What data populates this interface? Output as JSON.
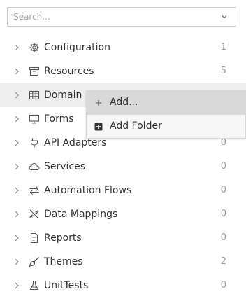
{
  "search": {
    "placeholder": "Search...",
    "value": ""
  },
  "tree": {
    "items": [
      {
        "label": "Configuration",
        "count": "1",
        "icon": "gear-icon"
      },
      {
        "label": "Resources",
        "count": "5",
        "icon": "archive-box-icon"
      },
      {
        "label": "Domain",
        "count": "",
        "icon": "table-grid-icon"
      },
      {
        "label": "Forms",
        "count": "",
        "icon": "monitor-icon"
      },
      {
        "label": "API Adapters",
        "count": "0",
        "icon": "plug-icon"
      },
      {
        "label": "Services",
        "count": "0",
        "icon": "cloud-icon"
      },
      {
        "label": "Automation Flows",
        "count": "0",
        "icon": "swap-arrows-icon"
      },
      {
        "label": "Data Mappings",
        "count": "0",
        "icon": "unlink-icon"
      },
      {
        "label": "Reports",
        "count": "0",
        "icon": "document-icon"
      },
      {
        "label": "Themes",
        "count": "2",
        "icon": "brush-icon"
      },
      {
        "label": "UnitTests",
        "count": "0",
        "icon": "flask-icon"
      }
    ]
  },
  "context_menu": {
    "items": [
      {
        "label": "Add...",
        "icon": "plus-icon"
      },
      {
        "label": "Add Folder",
        "icon": "add-folder-icon"
      }
    ]
  },
  "colors": {
    "hover_row": "#eeeeee",
    "menu_active": "#d9d9d9",
    "count_text": "#9a9a9a"
  }
}
